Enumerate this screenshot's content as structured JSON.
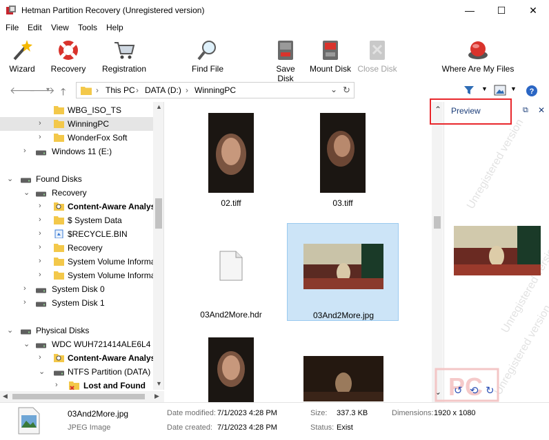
{
  "window": {
    "title": "Hetman Partition Recovery (Unregistered version)",
    "minimize": "—",
    "maximize": "☐",
    "close": "✕"
  },
  "menu": [
    "File",
    "Edit",
    "View",
    "Tools",
    "Help"
  ],
  "toolbar": {
    "wizard": "Wizard",
    "recovery": "Recovery",
    "registration": "Registration",
    "find_file": "Find File",
    "save_disk": "Save Disk",
    "mount_disk": "Mount Disk",
    "close_disk": "Close Disk",
    "where_files": "Where Are My Files"
  },
  "address": {
    "crumbs": [
      "This PC",
      "DATA (D:)",
      "WinningPC"
    ]
  },
  "tree": [
    {
      "label": "WBG_ISO_TS",
      "bold": false
    },
    {
      "label": "WinningPC",
      "bold": false
    },
    {
      "label": "WonderFox Soft",
      "bold": false
    },
    {
      "label": "Windows 11 (E:)",
      "bold": false
    },
    {
      "label": "Found Disks",
      "bold": false
    },
    {
      "label": "Recovery",
      "bold": false
    },
    {
      "label": "Content-Aware Analysis",
      "bold": true
    },
    {
      "label": "$ System Data",
      "bold": false
    },
    {
      "label": "$RECYCLE.BIN",
      "bold": false
    },
    {
      "label": "Recovery",
      "bold": false
    },
    {
      "label": "System Volume Information",
      "bold": false
    },
    {
      "label": "System Volume Information",
      "bold": false
    },
    {
      "label": "System Disk 0",
      "bold": false
    },
    {
      "label": "System Disk 1",
      "bold": false
    },
    {
      "label": "Physical Disks",
      "bold": false
    },
    {
      "label": "WDC  WUH721414ALE6L4",
      "bold": false
    },
    {
      "label": "Content-Aware Analysis",
      "bold": true
    },
    {
      "label": "NTFS Partition (DATA)",
      "bold": false
    },
    {
      "label": "Lost and Found",
      "bold": true
    }
  ],
  "files": [
    {
      "name": "02.tiff"
    },
    {
      "name": "03.tiff"
    },
    {
      "name": "03And2More.hdr"
    },
    {
      "name": "03And2More.jpg"
    }
  ],
  "preview": {
    "title": "Preview",
    "watermark": "Unregistered version"
  },
  "status": {
    "filename": "03And2More.jpg",
    "filetype": "JPEG Image",
    "date_modified_label": "Date modified:",
    "date_modified": "7/1/2023 4:28 PM",
    "date_created_label": "Date created:",
    "date_created": "7/1/2023 4:28 PM",
    "size_label": "Size:",
    "size": "337.3 KB",
    "status_label": "Status:",
    "status": "Exist",
    "dimensions_label": "Dimensions:",
    "dimensions": "1920 x 1080"
  }
}
